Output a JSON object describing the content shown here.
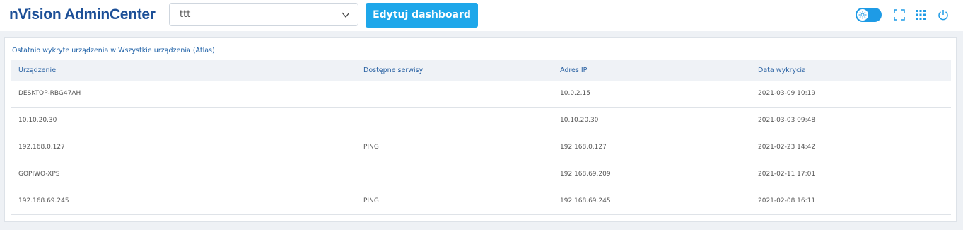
{
  "header": {
    "logo": "nVision AdminCenter",
    "dashboard_select": {
      "value": "ttt"
    },
    "edit_button": "Edytuj dashboard",
    "icons": [
      "theme-toggle-icon",
      "fullscreen-icon",
      "apps-grid-icon",
      "power-icon"
    ]
  },
  "panel": {
    "title": "Ostatnio wykryte urządzenia w Wszystkie urządzenia (Atlas)",
    "columns": [
      "Urządzenie",
      "Dostępne serwisy",
      "Adres IP",
      "Data wykrycia"
    ],
    "rows": [
      [
        "DESKTOP-RBG47AH",
        "",
        "10.0.2.15",
        "2021-03-09 10:19"
      ],
      [
        "10.10.20.30",
        "",
        "10.10.20.30",
        "2021-03-03 09:48"
      ],
      [
        "192.168.0.127",
        "PING",
        "192.168.0.127",
        "2021-02-23 14:42"
      ],
      [
        "GOPIWO-XPS",
        "",
        "192.168.69.209",
        "2021-02-11 17:01"
      ],
      [
        "192.168.69.245",
        "PING",
        "192.168.69.245",
        "2021-02-08 16:11"
      ]
    ]
  },
  "colors": {
    "brand": "#1c4f97",
    "accent": "#1ea7ea",
    "header_bg": "#eff2f6"
  }
}
